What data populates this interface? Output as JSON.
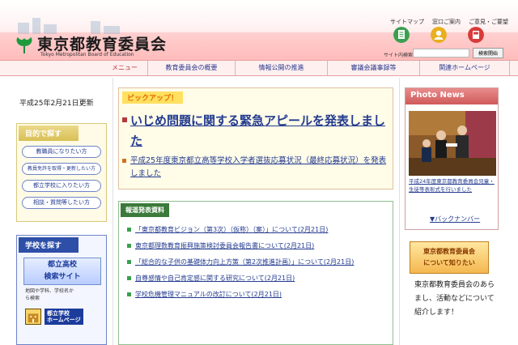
{
  "header": {
    "site_title": "東京都教育委員会",
    "site_subtitle": "Tokyo Metropolitan Board of Education",
    "util_links": [
      "サイトマップ",
      "窓口ご案内",
      "ご意見・ご要望"
    ],
    "site_search_label": "サイト内検索",
    "site_search_value": "",
    "site_search_button": "検索開始"
  },
  "nav": {
    "menu_label": "メニュー",
    "items": [
      "教育委員会の概要",
      "情報公開の推進",
      "審議会議事録等",
      "関連ホームページ"
    ]
  },
  "left": {
    "update_date": "平成25年2月21日更新",
    "purpose_title": "目的で探す",
    "purpose_items": [
      "教職員になりたい方",
      "教員免許を取得・更新したい方",
      "都立学校に入りたい方",
      "相談・質問等したい方"
    ],
    "school_title": "学校を探す",
    "toritsu_line1": "都立高校",
    "toritsu_line2": "検索サイト",
    "toritsu_desc_line1": "地図や学科、学校名か",
    "toritsu_desc_line2": "ら検索",
    "school_hp_line1": "都立学校",
    "school_hp_line2": "ホームページ"
  },
  "pickup": {
    "label": "ピックアップ！",
    "main": "いじめ問題に関する緊急アピールを発表しました",
    "sub": "平成25年度東京都立高等学校入学者選抜応募状況（最終応募状況）を発表しました"
  },
  "press": {
    "title": "報道発表資料",
    "items": [
      "「東京都教育ビジョン（第3次）（仮称）（案）」について(2月21日)",
      "東京都理数教育振興施策検討委員会報告書について(2月21日)",
      "「総合的な子供の基礎体力向上方策（第2次推進計画）」について(2月21日)",
      "自尊感情や自己肯定感に関する研究について(2月21日)",
      "学校危機管理マニュアルの改訂について(2月21日)"
    ]
  },
  "photo_news": {
    "title": "Photo News",
    "caption": "平成24年度東京都教育委員会児童・生徒等表彰式を行いました",
    "back_number": "▼バックナンバー"
  },
  "board": {
    "banner_line1": "東京都教育委員会",
    "banner_line2": "について知りたい",
    "description": "東京都教育委員会のあらまし、活動などについて紹介します！"
  },
  "colors": {
    "header_pink": "#ffbcbc",
    "link_blue": "#233b8f",
    "press_green": "#3b7a3b",
    "photo_red": "#cf5a5a",
    "purpose_gold": "#d9bf55",
    "school_blue": "#2e4fa8"
  },
  "icons": [
    "ginkgo-logo-icon",
    "sitemap-icon",
    "info-desk-icon",
    "opinion-mail-icon"
  ]
}
